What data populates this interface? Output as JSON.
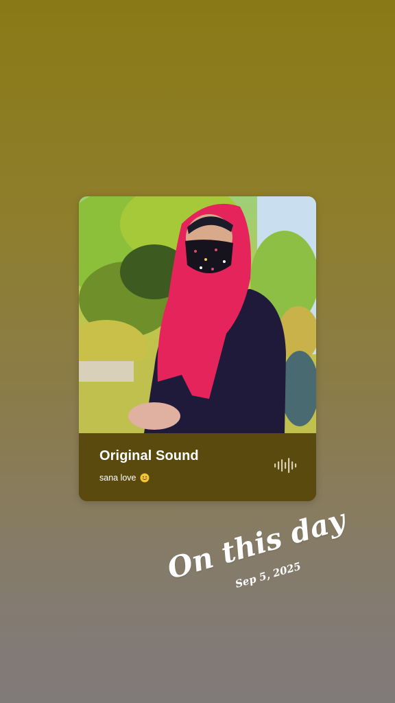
{
  "card": {
    "title": "Original Sound",
    "subtitle": "sana love"
  },
  "memory": {
    "title": "On this day",
    "date": "Sep 5, 2025"
  },
  "icons": {
    "wave": "audio-wave-icon",
    "emoji": "smiling-face-emoji-icon"
  },
  "colors": {
    "background_top": "#8a7a16",
    "background_bottom": "#807a7a",
    "card_info_bg": "#5b4a0d",
    "text": "#ffffff"
  }
}
